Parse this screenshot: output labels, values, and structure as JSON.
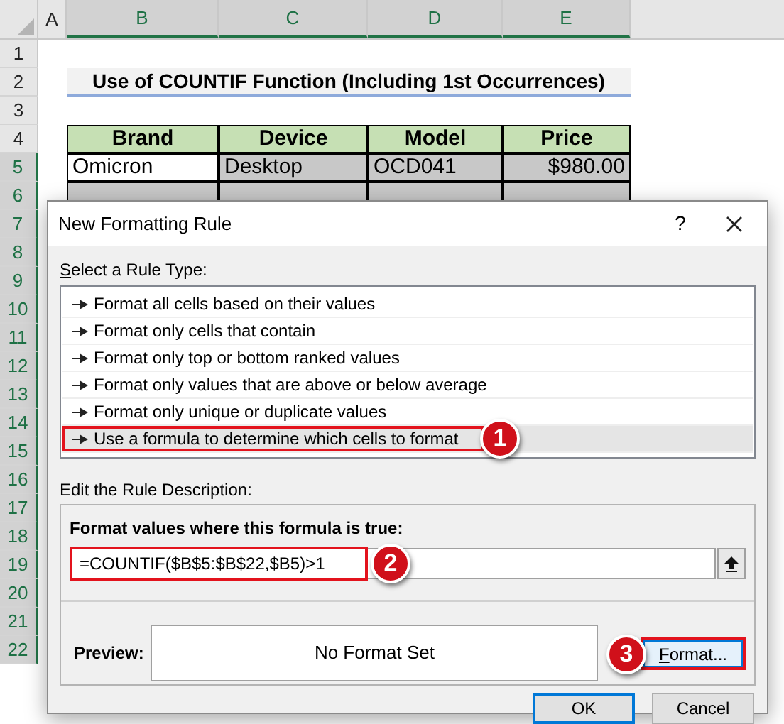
{
  "sheet": {
    "columns": [
      {
        "label": "A",
        "selected": false
      },
      {
        "label": "B",
        "selected": true
      },
      {
        "label": "C",
        "selected": true
      },
      {
        "label": "D",
        "selected": true
      },
      {
        "label": "E",
        "selected": true
      }
    ],
    "rows": [
      {
        "label": "1",
        "selected": false
      },
      {
        "label": "2",
        "selected": false
      },
      {
        "label": "3",
        "selected": false
      },
      {
        "label": "4",
        "selected": false
      },
      {
        "label": "5",
        "selected": true
      },
      {
        "label": "6",
        "selected": true
      },
      {
        "label": "7",
        "selected": true
      },
      {
        "label": "8",
        "selected": true
      },
      {
        "label": "9",
        "selected": true
      },
      {
        "label": "10",
        "selected": true
      },
      {
        "label": "11",
        "selected": true
      },
      {
        "label": "12",
        "selected": true
      },
      {
        "label": "13",
        "selected": true
      },
      {
        "label": "14",
        "selected": true
      },
      {
        "label": "15",
        "selected": true
      },
      {
        "label": "16",
        "selected": true
      },
      {
        "label": "17",
        "selected": true
      },
      {
        "label": "18",
        "selected": true
      },
      {
        "label": "19",
        "selected": true
      },
      {
        "label": "20",
        "selected": true
      },
      {
        "label": "21",
        "selected": true
      },
      {
        "label": "22",
        "selected": true
      }
    ],
    "title": "Use of COUNTIF Function (Including 1st Occurrences)",
    "table": {
      "columns": [
        "Brand",
        "Device",
        "Model",
        "Price"
      ],
      "rows": [
        {
          "cells": [
            "Omicron",
            "Desktop",
            "OCD041",
            "$980.00"
          ]
        }
      ]
    }
  },
  "dialog": {
    "title": "New Formatting Rule",
    "help": "?",
    "rule_type_label": "Select a Rule Type:",
    "rule_types": [
      {
        "label": "Format all cells based on their values",
        "selected": false
      },
      {
        "label": "Format only cells that contain",
        "selected": false
      },
      {
        "label": "Format only top or bottom ranked values",
        "selected": false
      },
      {
        "label": "Format only values that are above or below average",
        "selected": false
      },
      {
        "label": "Format only unique or duplicate values",
        "selected": false
      },
      {
        "label": "Use a formula to determine which cells to format",
        "selected": true,
        "callout": "1"
      }
    ],
    "description_label": "Edit the Rule Description:",
    "formula_label": "Format values where this formula is true:",
    "formula": {
      "value": "=COUNTIF($B$5:$B$22,$B5)>1",
      "callout": "2"
    },
    "preview_label": "Preview:",
    "preview_text": "No Format Set",
    "format_button": {
      "label": "Format...",
      "callout": "3"
    },
    "buttons": [
      {
        "label": "OK",
        "default": true
      },
      {
        "label": "Cancel",
        "default": false
      }
    ]
  }
}
